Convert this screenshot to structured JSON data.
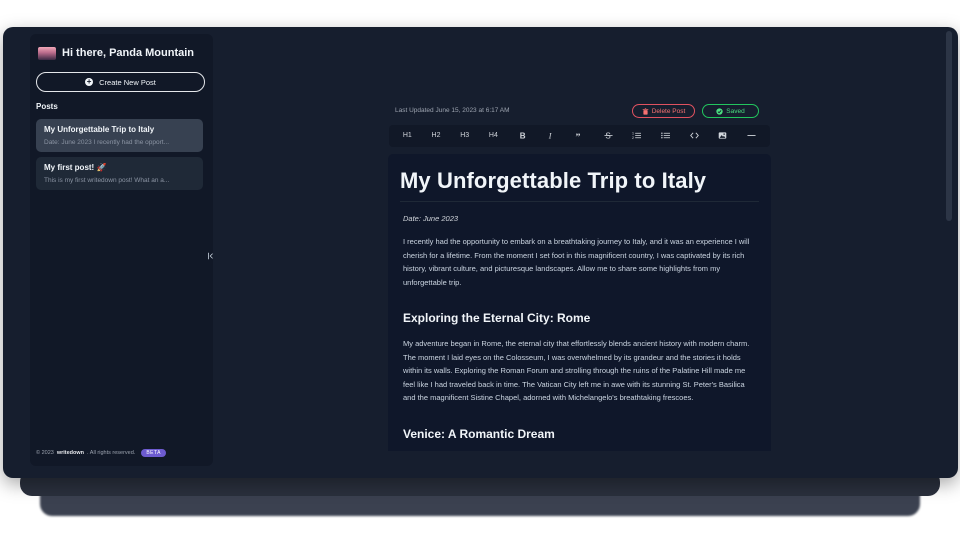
{
  "sidebar": {
    "greeting": "Hi there, Panda Mountain",
    "new_post_label": "Create New Post",
    "posts_heading": "Posts",
    "posts": [
      {
        "title": "My Unforgettable Trip to Italy",
        "excerpt": "Date: June 2023 I recently had the opport..."
      },
      {
        "title": "My first post! 🚀",
        "excerpt": "This is my first writedown post! What an a..."
      }
    ],
    "footer": {
      "copyright": "© 2023",
      "brand": "writedown",
      "rights": ". All rights reserved.",
      "badge": "BETA"
    }
  },
  "editor_meta": {
    "last_updated": "Last Updated June 15, 2023 at 6:17 AM",
    "delete_label": "Delete Post",
    "saved_label": "Saved"
  },
  "toolbar": {
    "h1": "H1",
    "h2": "H2",
    "h3": "H3",
    "h4": "H4"
  },
  "document": {
    "title": "My Unforgettable Trip to Italy",
    "date": "Date: June 2023",
    "intro": "I recently had the opportunity to embark on a breathtaking journey to Italy, and it was an experience I will cherish for a lifetime. From the moment I set foot in this magnificent country, I was captivated by its rich history, vibrant culture, and picturesque landscapes. Allow me to share some highlights from my unforgettable trip.",
    "section1_heading": "Exploring the Eternal City: Rome",
    "section1_body": "My adventure began in Rome, the eternal city that effortlessly blends ancient history with modern charm. The moment I laid eyes on the Colosseum, I was overwhelmed by its grandeur and the stories it holds within its walls. Exploring the Roman Forum and strolling through the ruins of the Palatine Hill made me feel like I had traveled back in time. The Vatican City left me in awe with its stunning St. Peter's Basilica and the magnificent Sistine Chapel, adorned with Michelangelo's breathtaking frescoes.",
    "section2_heading": "Venice: A Romantic Dream"
  },
  "colors": {
    "background": "#161e2e",
    "sidebar": "#111827",
    "editor": "#0f172a",
    "danger": "#f87171",
    "success": "#4ade80",
    "beta": "#6d5bd0"
  }
}
